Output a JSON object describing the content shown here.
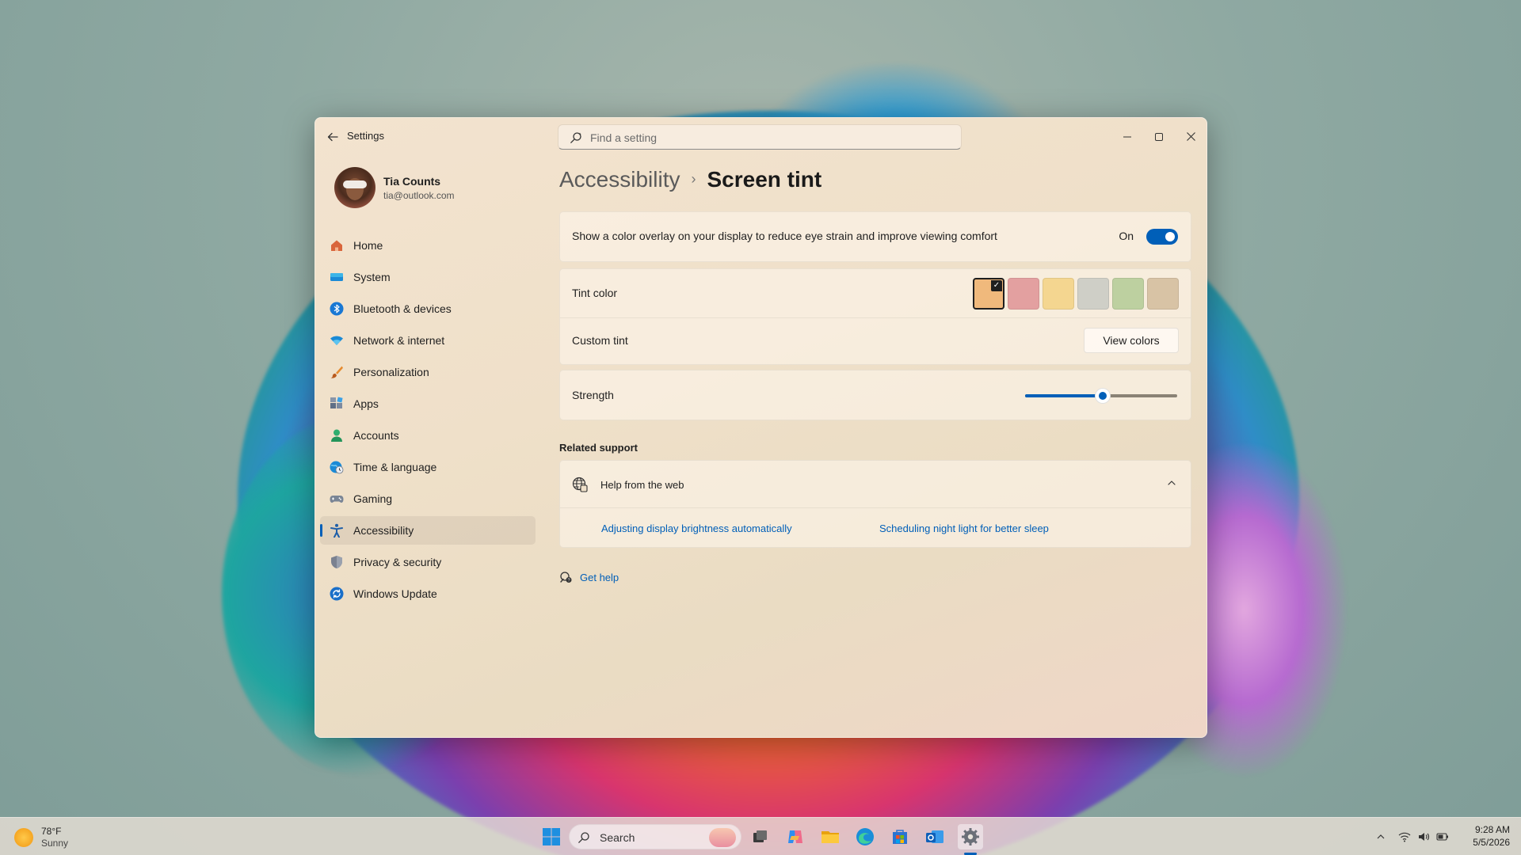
{
  "window": {
    "app_title": "Settings",
    "search_placeholder": "Find a setting"
  },
  "profile": {
    "name": "Tia Counts",
    "email": "tia@outlook.com"
  },
  "sidebar": {
    "items": [
      {
        "label": "Home",
        "icon": "home-icon",
        "selected": false
      },
      {
        "label": "System",
        "icon": "system-icon",
        "selected": false
      },
      {
        "label": "Bluetooth & devices",
        "icon": "bluetooth-icon",
        "selected": false
      },
      {
        "label": "Network & internet",
        "icon": "wifi-icon",
        "selected": false
      },
      {
        "label": "Personalization",
        "icon": "brush-icon",
        "selected": false
      },
      {
        "label": "Apps",
        "icon": "apps-icon",
        "selected": false
      },
      {
        "label": "Accounts",
        "icon": "account-icon",
        "selected": false
      },
      {
        "label": "Time & language",
        "icon": "globe-clock-icon",
        "selected": false
      },
      {
        "label": "Gaming",
        "icon": "gamepad-icon",
        "selected": false
      },
      {
        "label": "Accessibility",
        "icon": "accessibility-icon",
        "selected": true
      },
      {
        "label": "Privacy & security",
        "icon": "shield-icon",
        "selected": false
      },
      {
        "label": "Windows Update",
        "icon": "update-icon",
        "selected": false
      }
    ]
  },
  "breadcrumb": {
    "parent": "Accessibility",
    "separator": "›",
    "current": "Screen tint"
  },
  "overlay": {
    "label": "Show a color overlay on your display to reduce eye strain and improve viewing comfort",
    "state_text": "On",
    "enabled": true
  },
  "tint": {
    "label": "Tint color",
    "swatches": [
      "#f0b97c",
      "#e3a0a0",
      "#f4d690",
      "#cfcfc7",
      "#bdd0a0",
      "#d8c3a5"
    ],
    "selected_index": 0,
    "custom_label": "Custom tint",
    "view_colors_label": "View colors"
  },
  "strength": {
    "label": "Strength",
    "value_fraction": 0.51
  },
  "related": {
    "title": "Related support",
    "help_title": "Help from the web",
    "links": [
      "Adjusting display brightness automatically",
      "Scheduling night light for better sleep"
    ]
  },
  "get_help": "Get help",
  "taskbar": {
    "weather_temp": "78°F",
    "weather_desc": "Sunny",
    "search_label": "Search",
    "apps": [
      "start-icon",
      "task-view-icon",
      "copilot-icon",
      "file-explorer-icon",
      "edge-icon",
      "store-icon",
      "outlook-icon",
      "settings-icon"
    ],
    "time": "9:28 AM",
    "date": "5/5/2026"
  },
  "colors": {
    "accent": "#005fb8"
  }
}
